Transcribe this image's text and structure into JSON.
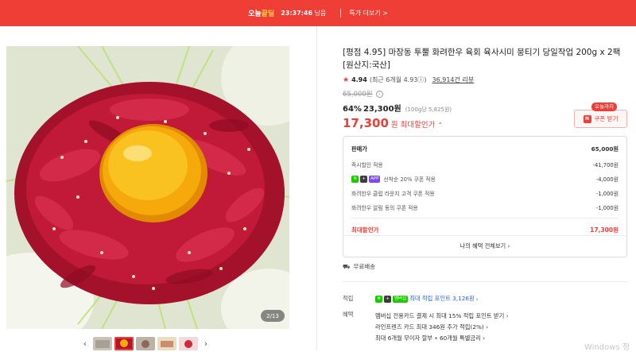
{
  "topbar": {
    "logo_left": "오늘",
    "logo_right": "끝딜",
    "timer": "23:37:46",
    "timer_suffix": "남음",
    "more_label": "특가 더보기",
    "more_arrow": ">"
  },
  "gallery": {
    "counter": "2/13",
    "prev_arrow": "‹",
    "next_arrow": "›"
  },
  "product": {
    "title": "[평점 4.95] 마장동 투뿔 화려한우 육회 육사시미 뭉티기 당일작업 200g x 2팩 [원산지:국산]",
    "rating_star": "★",
    "rating": "4.94",
    "rating_note": "(최근 6개월 4.93",
    "rating_info": "ⓘ",
    "rating_close": ")",
    "review_count": "36,914건 리뷰",
    "original_price": "65,000원",
    "discount_pct": "64%",
    "sale_price": "23,300원",
    "unit_price": "(100g당 5,825원)",
    "best_price": "17,300",
    "best_price_won": "원",
    "best_label": "최대할인가",
    "best_chevron": "⌃"
  },
  "coupon": {
    "tag": "오늘까지",
    "n_icon": "N",
    "label": "쿠폰 받기"
  },
  "price_box": {
    "rows": [
      {
        "label": "판매가",
        "value": "65,000원"
      },
      {
        "label": "즉시할인 적용",
        "value": "-41,700원"
      },
      {
        "label": "선착순 20% 쿠폰 적용",
        "value": "-4,000원",
        "badges": [
          "N",
          "+",
          "APP"
        ]
      },
      {
        "label": "화려한우 클럽 라운지 고객 쿠폰 적용",
        "value": "-1,000원"
      },
      {
        "label": "화려한우 알림 동의 쿠폰 적용",
        "value": "-1,000원"
      }
    ],
    "best_label": "최대할인가",
    "best_value": "17,300원",
    "more_button": "나의 혜택 전체보기",
    "more_arrow": "›"
  },
  "shipping": {
    "icon": "⛟",
    "label": "무료배송"
  },
  "earn": {
    "label": "적립",
    "badge_n": "N",
    "badge_plus": "+",
    "badge_text": "멤버십",
    "text": "최대 적립 포인트 3,126원",
    "arrow": "›"
  },
  "benefits": {
    "label": "혜택",
    "lines": [
      "멤버십 전용카드 결제 시 최대 15% 적립 포인트 받기 ›",
      "라인프렌즈 카드 최대 346원 추가 적립(2%) ›",
      "최대 6개월 무이자 할부 • 60개월 특별금리 ›"
    ]
  },
  "watermark": "Windows 정",
  "colors": {
    "brand_red": "#ef3e36",
    "link_blue": "#2c62d4",
    "naver_green": "#1ec800"
  }
}
